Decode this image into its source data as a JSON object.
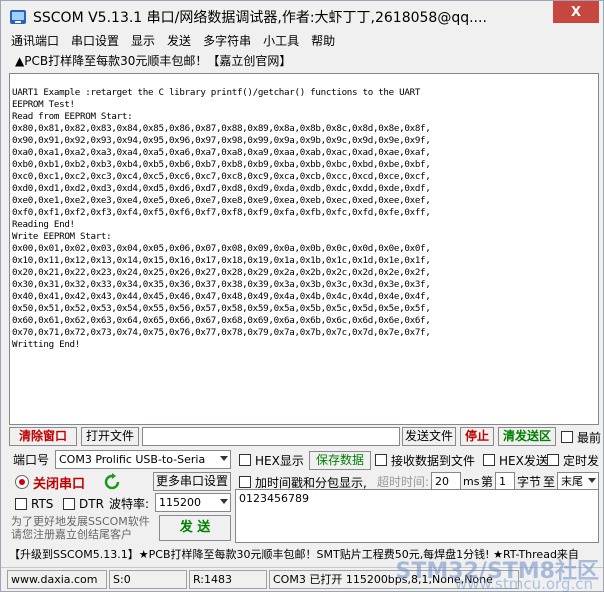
{
  "window": {
    "title": "SSCOM V5.13.1 串口/网络数据调试器,作者:大虾丁丁,2618058@qq....",
    "close_label": "X"
  },
  "menu": [
    "通讯端口",
    "串口设置",
    "显示",
    "发送",
    "多字符串",
    "小工具",
    "帮助"
  ],
  "ad_text": "▲PCB打样降至每款30元顺丰包邮！【嘉立创官网】",
  "receive_lines": [
    "UART1 Example :retarget the C library printf()/getchar() functions to the UART",
    "EEPROM Test!",
    "Read from EEPROM Start:",
    "0x80,0x81,0x82,0x83,0x84,0x85,0x86,0x87,0x88,0x89,0x8a,0x8b,0x8c,0x8d,0x8e,0x8f,",
    "0x90,0x91,0x92,0x93,0x94,0x95,0x96,0x97,0x98,0x99,0x9a,0x9b,0x9c,0x9d,0x9e,0x9f,",
    "0xa0,0xa1,0xa2,0xa3,0xa4,0xa5,0xa6,0xa7,0xa8,0xa9,0xaa,0xab,0xac,0xad,0xae,0xaf,",
    "0xb0,0xb1,0xb2,0xb3,0xb4,0xb5,0xb6,0xb7,0xb8,0xb9,0xba,0xbb,0xbc,0xbd,0xbe,0xbf,",
    "0xc0,0xc1,0xc2,0xc3,0xc4,0xc5,0xc6,0xc7,0xc8,0xc9,0xca,0xcb,0xcc,0xcd,0xce,0xcf,",
    "0xd0,0xd1,0xd2,0xd3,0xd4,0xd5,0xd6,0xd7,0xd8,0xd9,0xda,0xdb,0xdc,0xdd,0xde,0xdf,",
    "0xe0,0xe1,0xe2,0xe3,0xe4,0xe5,0xe6,0xe7,0xe8,0xe9,0xea,0xeb,0xec,0xed,0xee,0xef,",
    "0xf0,0xf1,0xf2,0xf3,0xf4,0xf5,0xf6,0xf7,0xf8,0xf9,0xfa,0xfb,0xfc,0xfd,0xfe,0xff,",
    "Reading End!",
    "Write EEPROM Start:",
    "0x00,0x01,0x02,0x03,0x04,0x05,0x06,0x07,0x08,0x09,0x0a,0x0b,0x0c,0x0d,0x0e,0x0f,",
    "0x10,0x11,0x12,0x13,0x14,0x15,0x16,0x17,0x18,0x19,0x1a,0x1b,0x1c,0x1d,0x1e,0x1f,",
    "0x20,0x21,0x22,0x23,0x24,0x25,0x26,0x27,0x28,0x29,0x2a,0x2b,0x2c,0x2d,0x2e,0x2f,",
    "0x30,0x31,0x32,0x33,0x34,0x35,0x36,0x37,0x38,0x39,0x3a,0x3b,0x3c,0x3d,0x3e,0x3f,",
    "0x40,0x41,0x42,0x43,0x44,0x45,0x46,0x47,0x48,0x49,0x4a,0x4b,0x4c,0x4d,0x4e,0x4f,",
    "0x50,0x51,0x52,0x53,0x54,0x55,0x56,0x57,0x58,0x59,0x5a,0x5b,0x5c,0x5d,0x5e,0x5f,",
    "0x60,0x61,0x62,0x63,0x64,0x65,0x66,0x67,0x68,0x69,0x6a,0x6b,0x6c,0x6d,0x6e,0x6f,",
    "0x70,0x71,0x72,0x73,0x74,0x75,0x76,0x77,0x78,0x79,0x7a,0x7b,0x7c,0x7d,0x7e,0x7f,",
    "Writting End!"
  ],
  "row1": {
    "clear_label": "清除窗口",
    "open_file_label": "打开文件",
    "file_path": "",
    "send_file_label": "发送文件",
    "stop_label": "停止",
    "clear_send_label": "清发送区",
    "last_label": "最前"
  },
  "row2": {
    "port_label": "端口号",
    "port_value": "COM3 Prolific USB-to-Seria",
    "hex_display_label": "HEX显示",
    "save_data_label": "保存数据",
    "recv_to_file_label": "接收数据到文件",
    "hex_send_label": "HEX发送",
    "timed_send_label": "定时发"
  },
  "row3": {
    "close_port_label": "关闭串口",
    "more_settings_label": "更多串口设置",
    "timestamp_label": "加时间戳和分包显示,",
    "timeout_label": "超时时间:",
    "timeout_value": "20",
    "timeout_unit": "ms",
    "nth_label": "第",
    "nth_value": "1",
    "byte_label": "字节",
    "to_label": "至",
    "end_value": "末尾"
  },
  "row4": {
    "rts_label": "RTS",
    "dtr_label": "DTR",
    "baud_label": "波特率:",
    "baud_value": "115200"
  },
  "send_area_text": "0123456789",
  "promo_lines": [
    "为了更好地发展SSCOM软件",
    "请您注册嘉立创结尾客户"
  ],
  "send_label": "发 送",
  "ticker": "【升级到SSCOM5.13.1】★PCB打样降至每款30元顺丰包邮！SMT贴片工程费50元,每焊盘1分钱! ★RT-Thread来自",
  "status": {
    "site": "www.daxia.com",
    "s_count": "S:0",
    "r_count": "R:1483",
    "port_status": "COM3 已打开  115200bps,8,1,None,None"
  },
  "watermark": {
    "line1": "STM32/STM8社区",
    "line2": "www.stmcu.org.cn"
  },
  "colors": {
    "accent_red": "#c00000",
    "accent_green": "#008000",
    "close_red": "#c7463e"
  }
}
